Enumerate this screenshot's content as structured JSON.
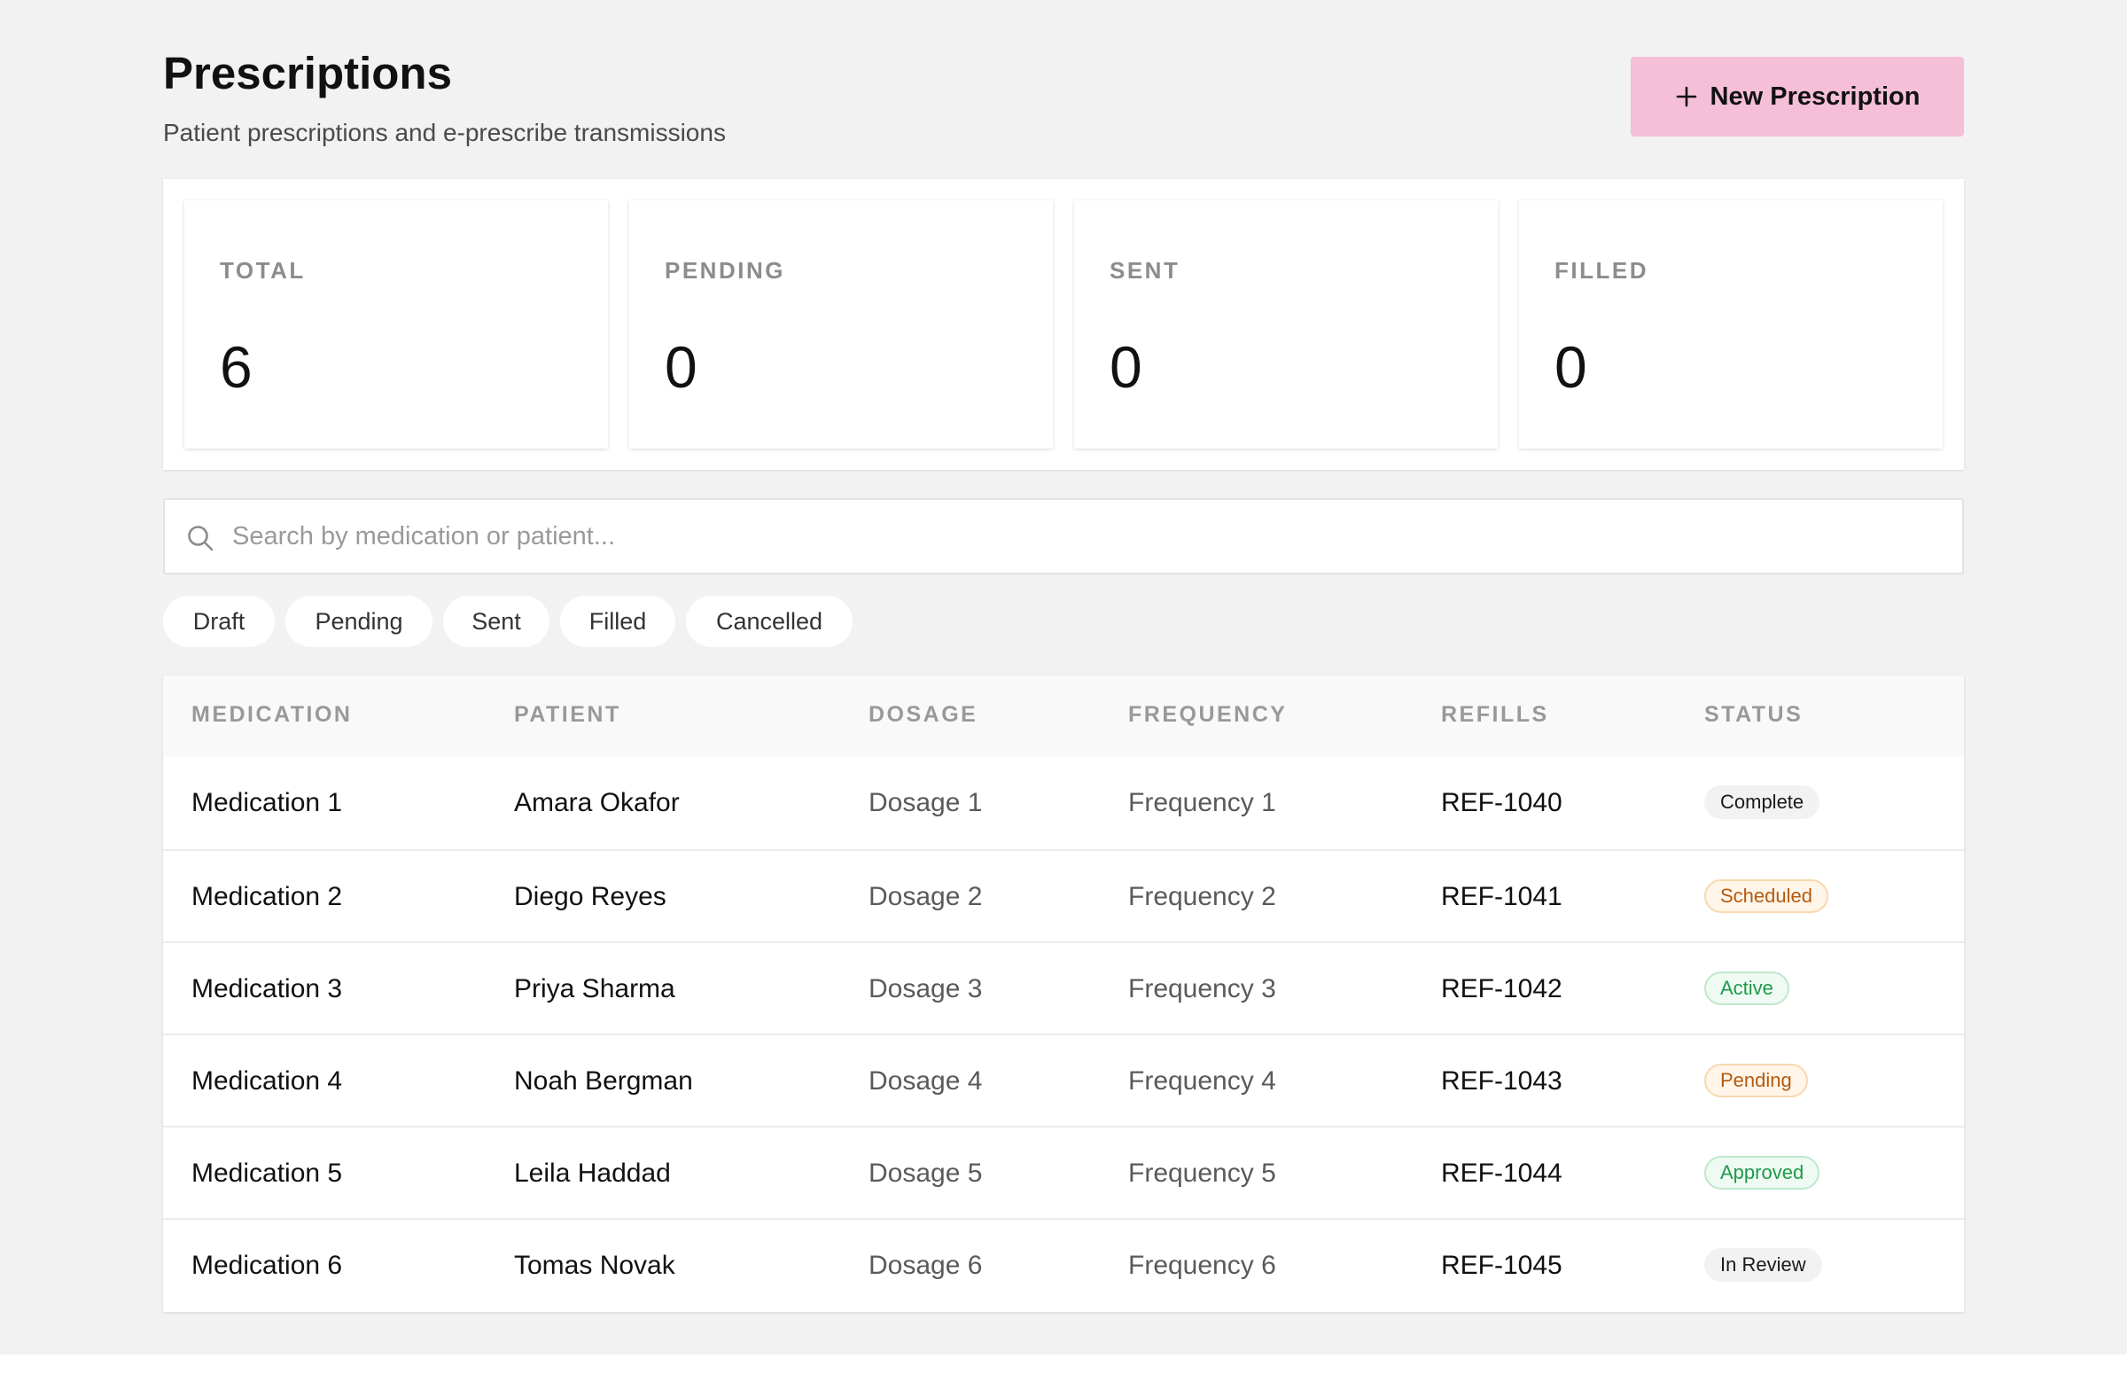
{
  "header": {
    "title": "Prescriptions",
    "subtitle": "Patient prescriptions and e-prescribe transmissions",
    "new_button_label": "New Prescription",
    "new_button_icon": "plus-icon"
  },
  "stats": [
    {
      "label": "TOTAL",
      "value": "6"
    },
    {
      "label": "PENDING",
      "value": "0"
    },
    {
      "label": "SENT",
      "value": "0"
    },
    {
      "label": "FILLED",
      "value": "0"
    }
  ],
  "search": {
    "icon": "search-icon",
    "placeholder": "Search by medication or patient...",
    "value": ""
  },
  "filters": [
    "Draft",
    "Pending",
    "Sent",
    "Filled",
    "Cancelled"
  ],
  "table": {
    "columns": [
      "MEDICATION",
      "PATIENT",
      "DOSAGE",
      "FREQUENCY",
      "REFILLS",
      "STATUS"
    ],
    "rows": [
      {
        "medication": "Medication 1",
        "patient": "Amara Okafor",
        "dosage": "Dosage 1",
        "frequency": "Frequency 1",
        "refills": "REF-1040",
        "status": "Complete"
      },
      {
        "medication": "Medication 2",
        "patient": "Diego Reyes",
        "dosage": "Dosage 2",
        "frequency": "Frequency 2",
        "refills": "REF-1041",
        "status": "Scheduled"
      },
      {
        "medication": "Medication 3",
        "patient": "Priya Sharma",
        "dosage": "Dosage 3",
        "frequency": "Frequency 3",
        "refills": "REF-1042",
        "status": "Active"
      },
      {
        "medication": "Medication 4",
        "patient": "Noah Bergman",
        "dosage": "Dosage 4",
        "frequency": "Frequency 4",
        "refills": "REF-1043",
        "status": "Pending"
      },
      {
        "medication": "Medication 5",
        "patient": "Leila Haddad",
        "dosage": "Dosage 5",
        "frequency": "Frequency 5",
        "refills": "REF-1044",
        "status": "Approved"
      },
      {
        "medication": "Medication 6",
        "patient": "Tomas Novak",
        "dosage": "Dosage 6",
        "frequency": "Frequency 6",
        "refills": "REF-1045",
        "status": "In Review"
      }
    ]
  },
  "colors": {
    "page_background": "#f2f2f2",
    "accent_button": "#f5bfd7",
    "status_neutral": "#f2f2f2",
    "status_orange": "#b55a10",
    "status_green": "#1f9a4a"
  }
}
